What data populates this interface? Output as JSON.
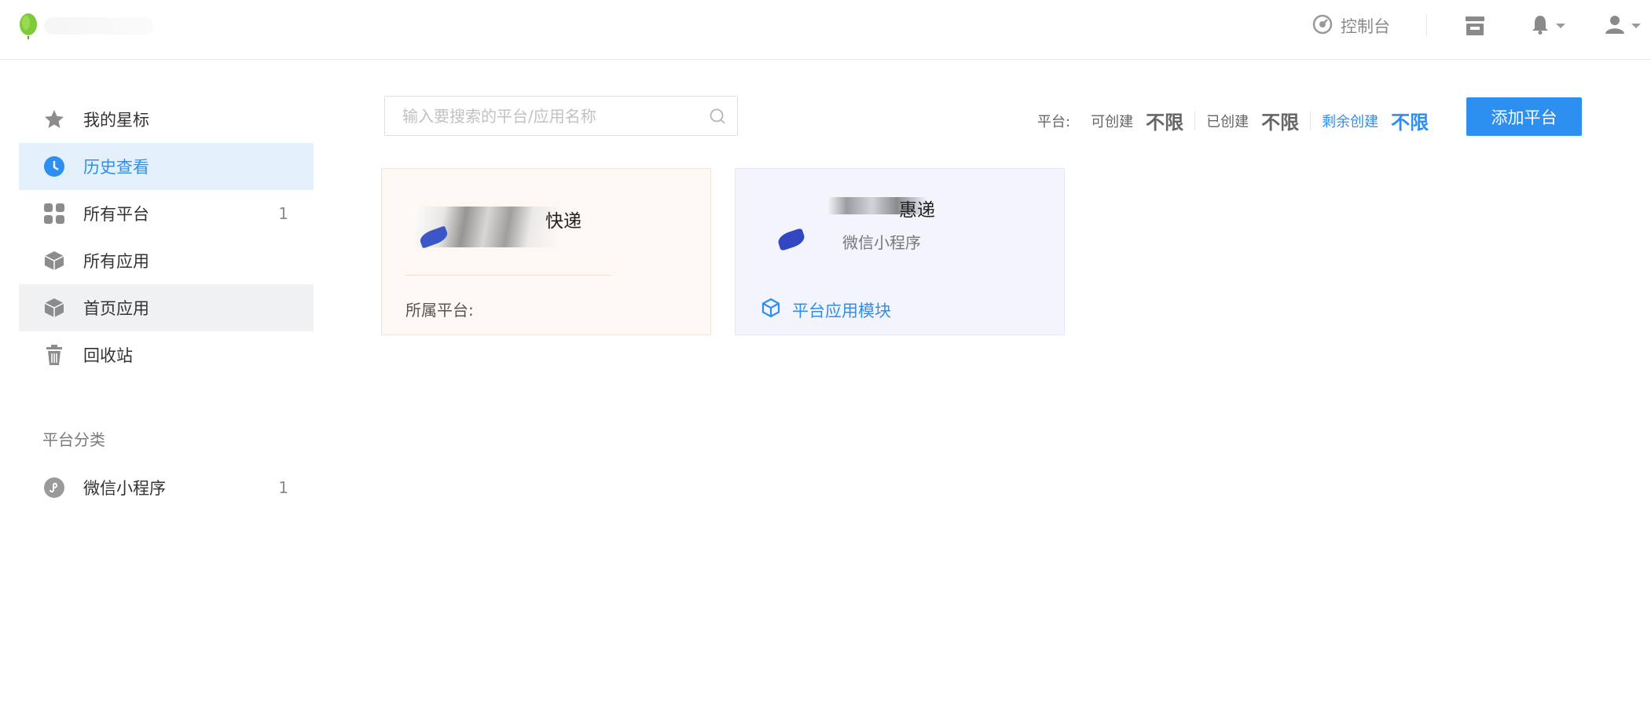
{
  "header": {
    "console_label": "控制台"
  },
  "sidebar": {
    "items": [
      {
        "label": "我的星标",
        "count": "",
        "icon": "star-icon"
      },
      {
        "label": "历史查看",
        "count": "",
        "icon": "clock-icon"
      },
      {
        "label": "所有平台",
        "count": "1",
        "icon": "grid-icon"
      },
      {
        "label": "所有应用",
        "count": "",
        "icon": "cube-icon"
      },
      {
        "label": "首页应用",
        "count": "",
        "icon": "cube-icon"
      },
      {
        "label": "回收站",
        "count": "",
        "icon": "trash-icon"
      }
    ],
    "section_title": "平台分类",
    "categories": [
      {
        "label": "微信小程序",
        "count": "1",
        "icon": "mini-program-icon"
      }
    ]
  },
  "search": {
    "placeholder": "输入要搜索的平台/应用名称"
  },
  "quota": {
    "prefix": "平台:",
    "can_create_label": "可创建",
    "can_create_value": "不限",
    "created_label": "已创建",
    "created_value": "不限",
    "remaining_label": "剩余创建",
    "remaining_value": "不限"
  },
  "add_button": "添加平台",
  "cards": [
    {
      "name_suffix": "快递",
      "meta_label": "所属平台:"
    },
    {
      "name_suffix": "惠递",
      "platform": "微信小程序",
      "module_label": "平台应用模块"
    }
  ],
  "colors": {
    "accent": "#2d8ff0",
    "active_bg": "#e4f1fd"
  }
}
